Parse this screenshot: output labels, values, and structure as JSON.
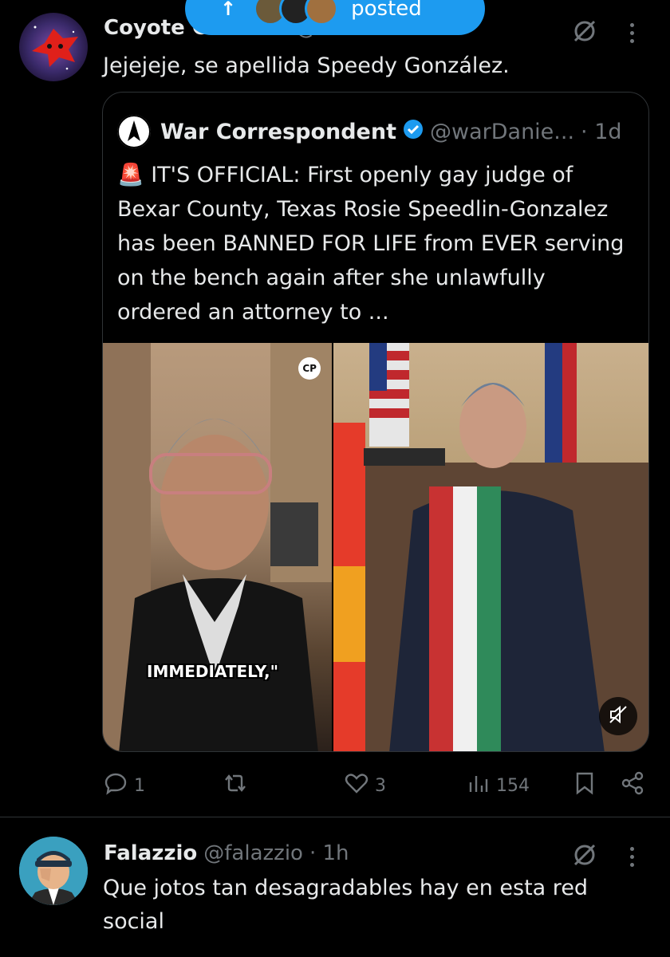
{
  "new_posts_pill": {
    "label": "posted"
  },
  "tweet1": {
    "display_name": "Coyote Cósmico",
    "handle": "@CORSE",
    "text": "Jejejeje, se apellida Speedy González.",
    "quote": {
      "display_name": "War Correspondent",
      "handle": "@warDanie...",
      "time": "· 1d",
      "text": "🚨 IT'S OFFICIAL: First openly gay judge of Bexar County, Texas Rosie Speedlin-Gonzalez has been BANNED FOR LIFE from EVER serving on the bench again after she unlawfully ordered an attorney to ...",
      "media_caption": "IMMEDIATELY,\"",
      "media_badge": "CP"
    },
    "actions": {
      "replies": "1",
      "reposts": "",
      "likes": "3",
      "views": "154"
    }
  },
  "tweet2": {
    "display_name": "Falazzio",
    "handle": "@falazzio",
    "time": "· 1h",
    "text": "Que jotos tan desagradables hay en esta red social"
  },
  "icons": [
    "grok-icon",
    "more-icon",
    "reply-icon",
    "repost-icon",
    "like-icon",
    "views-icon",
    "bookmark-icon",
    "share-icon",
    "verified-icon",
    "mute-icon"
  ],
  "colors": {
    "background": "#000000",
    "text": "#e7e9ea",
    "muted": "#71767b",
    "accent": "#1d9bf0",
    "border": "#2f3336"
  }
}
